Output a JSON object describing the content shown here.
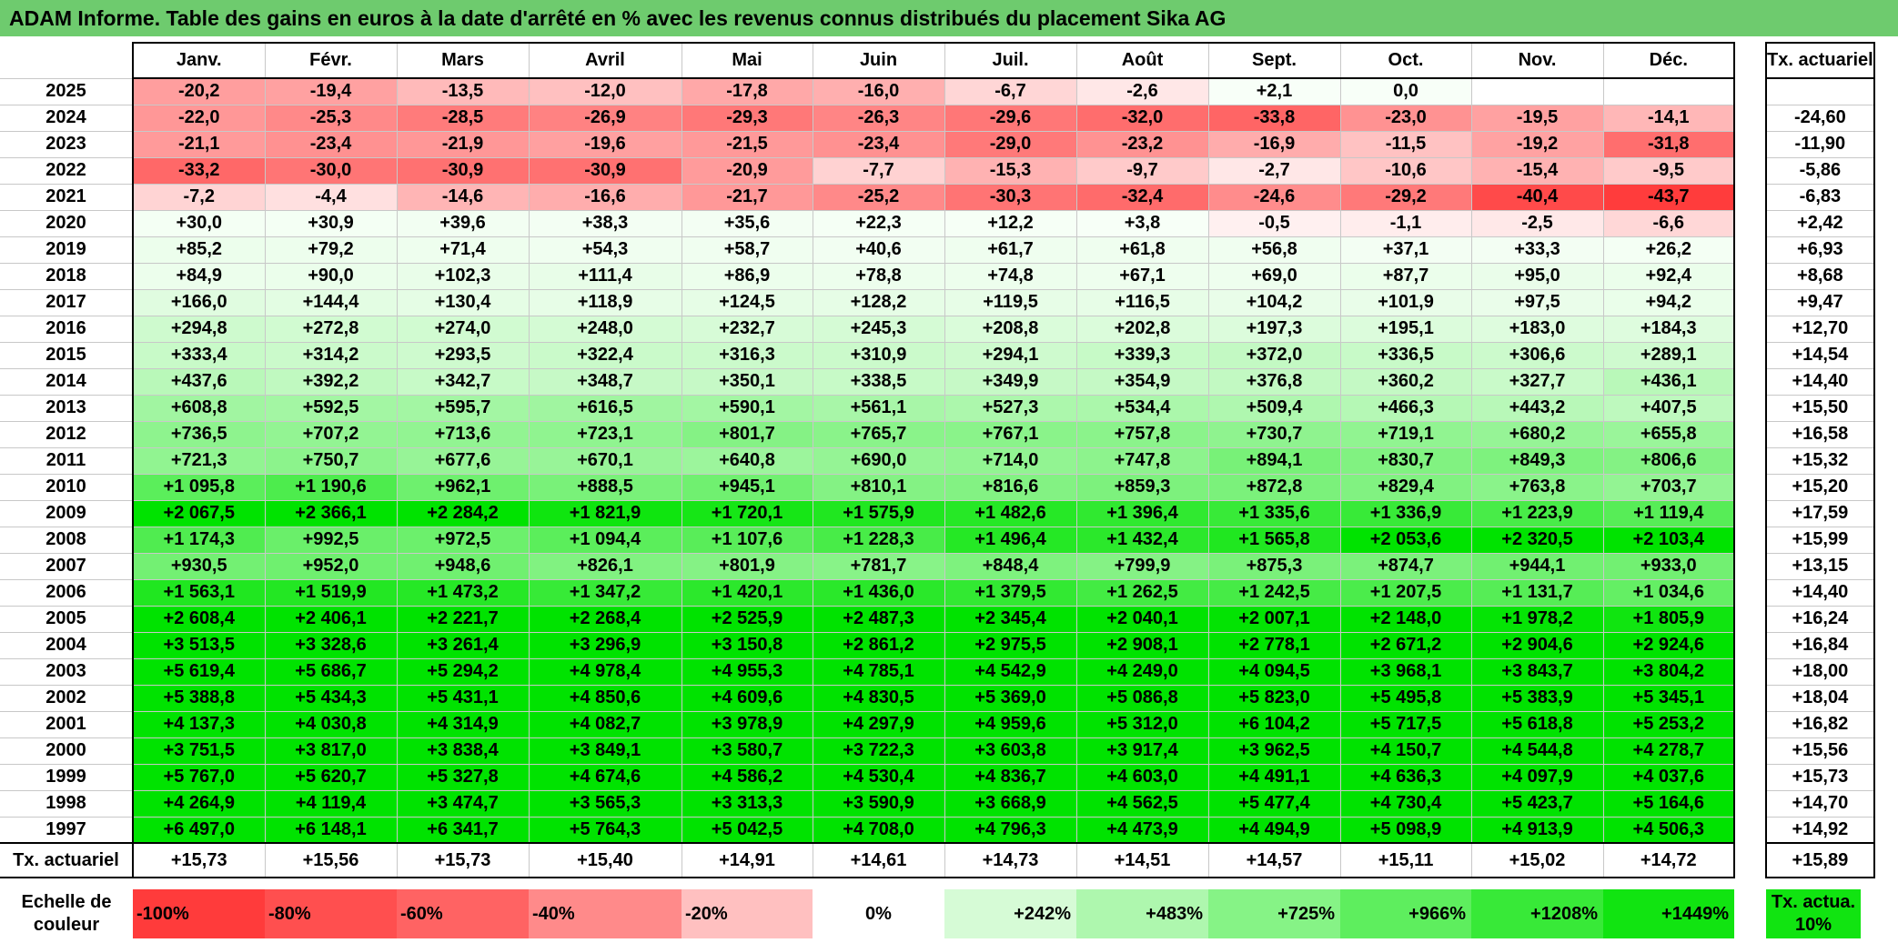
{
  "title": "ADAM Informe. Table des gains en euros à la date d'arrêté en % avec les revenus connus distribués du placement Sika AG",
  "months": [
    "Janv.",
    "Févr.",
    "Mars",
    "Avril",
    "Mai",
    "Juin",
    "Juil.",
    "Août",
    "Sept.",
    "Oct.",
    "Nov.",
    "Déc."
  ],
  "actuarial_header": "Tx. actuariel",
  "rows": [
    {
      "year": "2025",
      "values": [
        "-20,2",
        "-19,4",
        "-13,5",
        "-12,0",
        "-17,8",
        "-16,0",
        "-6,7",
        "-2,6",
        "+2,1",
        "0,0",
        "",
        ""
      ],
      "act": ""
    },
    {
      "year": "2024",
      "values": [
        "-22,0",
        "-25,3",
        "-28,5",
        "-26,9",
        "-29,3",
        "-26,3",
        "-29,6",
        "-32,0",
        "-33,8",
        "-23,0",
        "-19,5",
        "-14,1"
      ],
      "act": "-24,60"
    },
    {
      "year": "2023",
      "values": [
        "-21,1",
        "-23,4",
        "-21,9",
        "-19,6",
        "-21,5",
        "-23,4",
        "-29,0",
        "-23,2",
        "-16,9",
        "-11,5",
        "-19,2",
        "-31,8"
      ],
      "act": "-11,90"
    },
    {
      "year": "2022",
      "values": [
        "-33,2",
        "-30,0",
        "-30,9",
        "-30,9",
        "-20,9",
        "-7,7",
        "-15,3",
        "-9,7",
        "-2,7",
        "-10,6",
        "-15,4",
        "-9,5"
      ],
      "act": "-5,86"
    },
    {
      "year": "2021",
      "values": [
        "-7,2",
        "-4,4",
        "-14,6",
        "-16,6",
        "-21,7",
        "-25,2",
        "-30,3",
        "-32,4",
        "-24,6",
        "-29,2",
        "-40,4",
        "-43,7"
      ],
      "act": "-6,83"
    },
    {
      "year": "2020",
      "values": [
        "+30,0",
        "+30,9",
        "+39,6",
        "+38,3",
        "+35,6",
        "+22,3",
        "+12,2",
        "+3,8",
        "-0,5",
        "-1,1",
        "-2,5",
        "-6,6"
      ],
      "act": "+2,42"
    },
    {
      "year": "2019",
      "values": [
        "+85,2",
        "+79,2",
        "+71,4",
        "+54,3",
        "+58,7",
        "+40,6",
        "+61,7",
        "+61,8",
        "+56,8",
        "+37,1",
        "+33,3",
        "+26,2"
      ],
      "act": "+6,93"
    },
    {
      "year": "2018",
      "values": [
        "+84,9",
        "+90,0",
        "+102,3",
        "+111,4",
        "+86,9",
        "+78,8",
        "+74,8",
        "+67,1",
        "+69,0",
        "+87,7",
        "+95,0",
        "+92,4"
      ],
      "act": "+8,68"
    },
    {
      "year": "2017",
      "values": [
        "+166,0",
        "+144,4",
        "+130,4",
        "+118,9",
        "+124,5",
        "+128,2",
        "+119,5",
        "+116,5",
        "+104,2",
        "+101,9",
        "+97,5",
        "+94,2"
      ],
      "act": "+9,47"
    },
    {
      "year": "2016",
      "values": [
        "+294,8",
        "+272,8",
        "+274,0",
        "+248,0",
        "+232,7",
        "+245,3",
        "+208,8",
        "+202,8",
        "+197,3",
        "+195,1",
        "+183,0",
        "+184,3"
      ],
      "act": "+12,70"
    },
    {
      "year": "2015",
      "values": [
        "+333,4",
        "+314,2",
        "+293,5",
        "+322,4",
        "+316,3",
        "+310,9",
        "+294,1",
        "+339,3",
        "+372,0",
        "+336,5",
        "+306,6",
        "+289,1"
      ],
      "act": "+14,54"
    },
    {
      "year": "2014",
      "values": [
        "+437,6",
        "+392,2",
        "+342,7",
        "+348,7",
        "+350,1",
        "+338,5",
        "+349,9",
        "+354,9",
        "+376,8",
        "+360,2",
        "+327,7",
        "+436,1"
      ],
      "act": "+14,40"
    },
    {
      "year": "2013",
      "values": [
        "+608,8",
        "+592,5",
        "+595,7",
        "+616,5",
        "+590,1",
        "+561,1",
        "+527,3",
        "+534,4",
        "+509,4",
        "+466,3",
        "+443,2",
        "+407,5"
      ],
      "act": "+15,50"
    },
    {
      "year": "2012",
      "values": [
        "+736,5",
        "+707,2",
        "+713,6",
        "+723,1",
        "+801,7",
        "+765,7",
        "+767,1",
        "+757,8",
        "+730,7",
        "+719,1",
        "+680,2",
        "+655,8"
      ],
      "act": "+16,58"
    },
    {
      "year": "2011",
      "values": [
        "+721,3",
        "+750,7",
        "+677,6",
        "+670,1",
        "+640,8",
        "+690,0",
        "+714,0",
        "+747,8",
        "+894,1",
        "+830,7",
        "+849,3",
        "+806,6"
      ],
      "act": "+15,32"
    },
    {
      "year": "2010",
      "values": [
        "+1 095,8",
        "+1 190,6",
        "+962,1",
        "+888,5",
        "+945,1",
        "+810,1",
        "+816,6",
        "+859,3",
        "+872,8",
        "+829,4",
        "+763,8",
        "+703,7"
      ],
      "act": "+15,20"
    },
    {
      "year": "2009",
      "values": [
        "+2 067,5",
        "+2 366,1",
        "+2 284,2",
        "+1 821,9",
        "+1 720,1",
        "+1 575,9",
        "+1 482,6",
        "+1 396,4",
        "+1 335,6",
        "+1 336,9",
        "+1 223,9",
        "+1 119,4"
      ],
      "act": "+17,59"
    },
    {
      "year": "2008",
      "values": [
        "+1 174,3",
        "+992,5",
        "+972,5",
        "+1 094,4",
        "+1 107,6",
        "+1 228,3",
        "+1 496,4",
        "+1 432,4",
        "+1 565,8",
        "+2 053,6",
        "+2 320,5",
        "+2 103,4"
      ],
      "act": "+15,99"
    },
    {
      "year": "2007",
      "values": [
        "+930,5",
        "+952,0",
        "+948,6",
        "+826,1",
        "+801,9",
        "+781,7",
        "+848,4",
        "+799,9",
        "+875,3",
        "+874,7",
        "+944,1",
        "+933,0"
      ],
      "act": "+13,15"
    },
    {
      "year": "2006",
      "values": [
        "+1 563,1",
        "+1 519,9",
        "+1 473,2",
        "+1 347,2",
        "+1 420,1",
        "+1 436,0",
        "+1 379,5",
        "+1 262,5",
        "+1 242,5",
        "+1 207,5",
        "+1 131,7",
        "+1 034,6"
      ],
      "act": "+14,40"
    },
    {
      "year": "2005",
      "values": [
        "+2 608,4",
        "+2 406,1",
        "+2 221,7",
        "+2 268,4",
        "+2 525,9",
        "+2 487,3",
        "+2 345,4",
        "+2 040,1",
        "+2 007,1",
        "+2 148,0",
        "+1 978,2",
        "+1 805,9"
      ],
      "act": "+16,24"
    },
    {
      "year": "2004",
      "values": [
        "+3 513,5",
        "+3 328,6",
        "+3 261,4",
        "+3 296,9",
        "+3 150,8",
        "+2 861,2",
        "+2 975,5",
        "+2 908,1",
        "+2 778,1",
        "+2 671,2",
        "+2 904,6",
        "+2 924,6"
      ],
      "act": "+16,84"
    },
    {
      "year": "2003",
      "values": [
        "+5 619,4",
        "+5 686,7",
        "+5 294,2",
        "+4 978,4",
        "+4 955,3",
        "+4 785,1",
        "+4 542,9",
        "+4 249,0",
        "+4 094,5",
        "+3 968,1",
        "+3 843,7",
        "+3 804,2"
      ],
      "act": "+18,00"
    },
    {
      "year": "2002",
      "values": [
        "+5 388,8",
        "+5 434,3",
        "+5 431,1",
        "+4 850,6",
        "+4 609,6",
        "+4 830,5",
        "+5 369,0",
        "+5 086,8",
        "+5 823,0",
        "+5 495,8",
        "+5 383,9",
        "+5 345,1"
      ],
      "act": "+18,04"
    },
    {
      "year": "2001",
      "values": [
        "+4 137,3",
        "+4 030,8",
        "+4 314,9",
        "+4 082,7",
        "+3 978,9",
        "+4 297,9",
        "+4 959,6",
        "+5 312,0",
        "+6 104,2",
        "+5 717,5",
        "+5 618,8",
        "+5 253,2"
      ],
      "act": "+16,82"
    },
    {
      "year": "2000",
      "values": [
        "+3 751,5",
        "+3 817,0",
        "+3 838,4",
        "+3 849,1",
        "+3 580,7",
        "+3 722,3",
        "+3 603,8",
        "+3 917,4",
        "+3 962,5",
        "+4 150,7",
        "+4 544,8",
        "+4 278,7"
      ],
      "act": "+15,56"
    },
    {
      "year": "1999",
      "values": [
        "+5 767,0",
        "+5 620,7",
        "+5 327,8",
        "+4 674,6",
        "+4 586,2",
        "+4 530,4",
        "+4 836,7",
        "+4 603,0",
        "+4 491,1",
        "+4 636,3",
        "+4 097,9",
        "+4 037,6"
      ],
      "act": "+15,73"
    },
    {
      "year": "1998",
      "values": [
        "+4 264,9",
        "+4 119,4",
        "+3 474,7",
        "+3 565,3",
        "+3 313,3",
        "+3 590,9",
        "+3 668,9",
        "+4 562,5",
        "+5 477,4",
        "+4 730,4",
        "+5 423,7",
        "+5 164,6"
      ],
      "act": "+14,70"
    },
    {
      "year": "1997",
      "values": [
        "+6 497,0",
        "+6 148,1",
        "+6 341,7",
        "+5 764,3",
        "+5 042,5",
        "+4 708,0",
        "+4 796,3",
        "+4 473,9",
        "+4 494,9",
        "+5 098,9",
        "+4 913,9",
        "+4 506,3"
      ],
      "act": "+14,92"
    }
  ],
  "totals": {
    "label": "Tx. actuariel",
    "values": [
      "+15,73",
      "+15,56",
      "+15,73",
      "+15,40",
      "+14,91",
      "+14,61",
      "+14,73",
      "+14,51",
      "+14,57",
      "+15,11",
      "+15,02",
      "+14,72"
    ],
    "act": "+15,89"
  },
  "scale": {
    "label": "Echelle de couleur",
    "items": [
      {
        "label": "-100%",
        "color": "#ff3b3b"
      },
      {
        "label": "-80%",
        "color": "#ff4f4f"
      },
      {
        "label": "-60%",
        "color": "#ff6363"
      },
      {
        "label": "-40%",
        "color": "#ff8a8a"
      },
      {
        "label": "-20%",
        "color": "#ffc0c0"
      },
      {
        "label": "0%",
        "color": "#ffffff"
      },
      {
        "label": "+242%",
        "color": "#d6fbd6"
      },
      {
        "label": "+483%",
        "color": "#aef7ae"
      },
      {
        "label": "+725%",
        "color": "#86f386"
      },
      {
        "label": "+966%",
        "color": "#5eee5e"
      },
      {
        "label": "+1208%",
        "color": "#38e938"
      },
      {
        "label": "+1449%",
        "color": "#11e411"
      }
    ],
    "act_label": "Tx. actua. 10%",
    "act_color": "#11e411"
  }
}
